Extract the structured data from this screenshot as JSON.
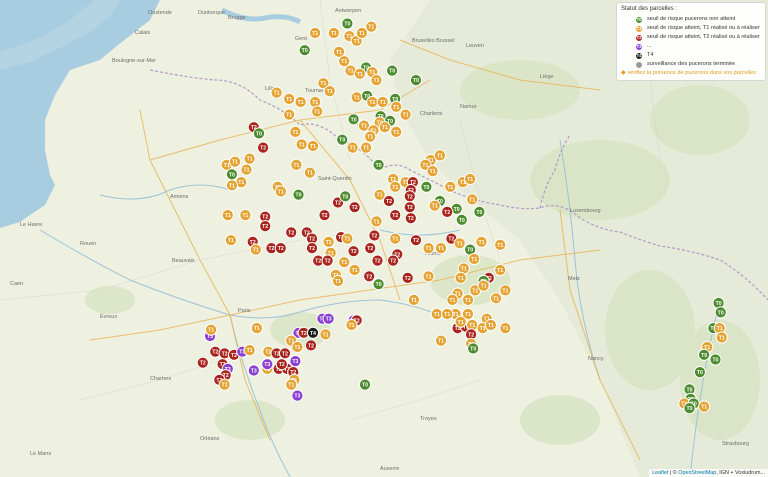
{
  "colors": {
    "T0": "#4c8c2f",
    "T1": "#e5a333",
    "T2": "#a8241d",
    "T3": "#8a3fd1",
    "T4": "#1a1a1a",
    "done": "#9a9a9a",
    "link": "#e69a1c"
  },
  "place_labels": [
    "Oostende",
    "Brugge",
    "Gent",
    "Antwerpen",
    "Bruxelles Brussel",
    "Leuven",
    "Liège",
    "Namur",
    "Charleroi",
    "Mons",
    "Lille",
    "Tournai",
    "Dunkerque",
    "Calais",
    "Boulogne-sur-Mer",
    "Amiens",
    "Saint-Quentin",
    "Reims",
    "Paris",
    "Beauvais",
    "Rouen",
    "Le Havre",
    "Caen",
    "Chartres",
    "Orléans",
    "Troyes",
    "Metz",
    "Nancy",
    "Luxembourg",
    "Strasbourg",
    "Évreux",
    "Le Mans",
    "Auxerre"
  ],
  "legend": {
    "title": "Statut des parcelles :",
    "items": [
      {
        "badge": "T0",
        "label": "seuil de risque pucerons non atteint",
        "color_key": "T0"
      },
      {
        "badge": "T1",
        "label": "seuil de risque atteint, T1 réalisé ou à réaliser",
        "color_key": "T1"
      },
      {
        "badge": "T2",
        "label": "seuil de risque atteint, T2 réalisé ou à réaliser",
        "color_key": "T2"
      },
      {
        "badge": "T3",
        "label": "...",
        "color_key": "T3"
      },
      {
        "badge": "T4",
        "label": "T4",
        "color_key": "T4"
      },
      {
        "badge": "",
        "label": "surveillance des pucerons terminée",
        "color_key": "done"
      }
    ],
    "link": "vérifiez la présence de pucerons dans vos parcelles"
  },
  "attribution": {
    "leaflet": "Leaflet",
    "sep": " | © ",
    "osm": "OpenStreetMap",
    "rest": ", IGN + Voxiudrum..."
  },
  "markers": [
    {
      "t": "T0",
      "lng": 2.84,
      "lat": 51.29
    },
    {
      "t": "T1",
      "lng": 2.53,
      "lat": 51.23
    },
    {
      "t": "T1",
      "lng": 2.71,
      "lat": 51.23
    },
    {
      "t": "T1",
      "lng": 2.86,
      "lat": 51.21
    },
    {
      "t": "T1",
      "lng": 2.93,
      "lat": 51.18
    },
    {
      "t": "T1",
      "lng": 2.98,
      "lat": 51.23
    },
    {
      "t": "T1",
      "lng": 3.07,
      "lat": 51.27
    },
    {
      "t": "T0",
      "lng": 2.43,
      "lat": 51.12
    },
    {
      "t": "T1",
      "lng": 2.76,
      "lat": 51.11
    },
    {
      "t": "T1",
      "lng": 2.81,
      "lat": 51.05
    },
    {
      "t": "T0",
      "lng": 3.02,
      "lat": 51.01
    },
    {
      "t": "T1",
      "lng": 2.87,
      "lat": 50.99
    },
    {
      "t": "T1",
      "lng": 2.96,
      "lat": 50.97
    },
    {
      "t": "T1",
      "lng": 3.08,
      "lat": 50.98
    },
    {
      "t": "T1",
      "lng": 3.12,
      "lat": 50.93
    },
    {
      "t": "T0",
      "lng": 3.27,
      "lat": 50.99
    },
    {
      "t": "T0",
      "lng": 3.5,
      "lat": 50.93
    },
    {
      "t": "T1",
      "lng": 2.61,
      "lat": 50.91
    },
    {
      "t": "T1",
      "lng": 2.67,
      "lat": 50.86
    },
    {
      "t": "T1",
      "lng": 2.16,
      "lat": 50.85
    },
    {
      "t": "T1",
      "lng": 2.28,
      "lat": 50.81
    },
    {
      "t": "T1",
      "lng": 2.39,
      "lat": 50.79
    },
    {
      "t": "T1",
      "lng": 2.53,
      "lat": 50.79
    },
    {
      "t": "T1",
      "lng": 2.93,
      "lat": 50.82
    },
    {
      "t": "T0",
      "lng": 3.03,
      "lat": 50.83
    },
    {
      "t": "T1",
      "lng": 3.08,
      "lat": 50.79
    },
    {
      "t": "T1",
      "lng": 3.18,
      "lat": 50.79
    },
    {
      "t": "T0",
      "lng": 3.3,
      "lat": 50.81
    },
    {
      "t": "T1",
      "lng": 3.31,
      "lat": 50.76
    },
    {
      "t": "T1",
      "lng": 2.28,
      "lat": 50.71
    },
    {
      "t": "T1",
      "lng": 2.55,
      "lat": 50.73
    },
    {
      "t": "T0",
      "lng": 2.9,
      "lat": 50.68
    },
    {
      "t": "T0",
      "lng": 3.16,
      "lat": 50.7
    },
    {
      "t": "T0",
      "lng": 3.25,
      "lat": 50.67
    },
    {
      "t": "T1",
      "lng": 3.4,
      "lat": 50.71
    },
    {
      "t": "T1",
      "lng": 3.15,
      "lat": 50.66
    },
    {
      "t": "T1",
      "lng": 3.2,
      "lat": 50.63
    },
    {
      "t": "T1",
      "lng": 3.0,
      "lat": 50.64
    },
    {
      "t": "T1",
      "lng": 3.09,
      "lat": 50.61
    },
    {
      "t": "T1",
      "lng": 3.06,
      "lat": 50.57
    },
    {
      "t": "T1",
      "lng": 3.31,
      "lat": 50.6
    },
    {
      "t": "T2",
      "lng": 1.94,
      "lat": 50.63
    },
    {
      "t": "T0",
      "lng": 1.99,
      "lat": 50.59
    },
    {
      "t": "T1",
      "lng": 2.34,
      "lat": 50.6
    },
    {
      "t": "T0",
      "lng": 2.79,
      "lat": 50.55
    },
    {
      "t": "T2",
      "lng": 2.03,
      "lat": 50.5
    },
    {
      "t": "T1",
      "lng": 2.4,
      "lat": 50.52
    },
    {
      "t": "T1",
      "lng": 2.51,
      "lat": 50.51
    },
    {
      "t": "T1",
      "lng": 2.89,
      "lat": 50.5
    },
    {
      "t": "T1",
      "lng": 3.02,
      "lat": 50.5
    },
    {
      "t": "T1",
      "lng": 1.68,
      "lat": 50.39
    },
    {
      "t": "T1",
      "lng": 1.76,
      "lat": 50.41
    },
    {
      "t": "T1",
      "lng": 1.9,
      "lat": 50.43
    },
    {
      "t": "T0",
      "lng": 1.73,
      "lat": 50.33
    },
    {
      "t": "T1",
      "lng": 1.87,
      "lat": 50.36
    },
    {
      "t": "T1",
      "lng": 2.35,
      "lat": 50.39
    },
    {
      "t": "T1",
      "lng": 2.48,
      "lat": 50.34
    },
    {
      "t": "T0",
      "lng": 3.14,
      "lat": 50.39
    },
    {
      "t": "T1",
      "lng": 3.64,
      "lat": 50.42
    },
    {
      "t": "T1",
      "lng": 3.73,
      "lat": 50.45
    },
    {
      "t": "T1",
      "lng": 3.59,
      "lat": 50.39
    },
    {
      "t": "T1",
      "lng": 3.66,
      "lat": 50.35
    },
    {
      "t": "T1",
      "lng": 1.82,
      "lat": 50.28
    },
    {
      "t": "T1",
      "lng": 1.73,
      "lat": 50.26
    },
    {
      "t": "T1",
      "lng": 2.17,
      "lat": 50.25
    },
    {
      "t": "T1",
      "lng": 2.2,
      "lat": 50.22
    },
    {
      "t": "T0",
      "lng": 2.37,
      "lat": 50.2
    },
    {
      "t": "T2",
      "lng": 2.75,
      "lat": 50.15
    },
    {
      "t": "T0",
      "lng": 2.82,
      "lat": 50.19
    },
    {
      "t": "T1",
      "lng": 3.28,
      "lat": 50.3
    },
    {
      "t": "T1",
      "lng": 3.3,
      "lat": 50.25
    },
    {
      "t": "T1",
      "lng": 3.15,
      "lat": 50.2
    },
    {
      "t": "T1",
      "lng": 3.4,
      "lat": 50.28
    },
    {
      "t": "T2",
      "lng": 3.47,
      "lat": 50.28
    },
    {
      "t": "T2",
      "lng": 3.45,
      "lat": 50.23
    },
    {
      "t": "T0",
      "lng": 3.6,
      "lat": 50.25
    },
    {
      "t": "T1",
      "lng": 3.83,
      "lat": 50.25
    },
    {
      "t": "T1",
      "lng": 3.95,
      "lat": 50.28
    },
    {
      "t": "T1",
      "lng": 4.02,
      "lat": 50.3
    },
    {
      "t": "T2",
      "lng": 2.91,
      "lat": 50.12
    },
    {
      "t": "T2",
      "lng": 3.24,
      "lat": 50.16
    },
    {
      "t": "T2",
      "lng": 3.44,
      "lat": 50.19
    },
    {
      "t": "T2",
      "lng": 3.44,
      "lat": 50.12
    },
    {
      "t": "T0",
      "lng": 3.73,
      "lat": 50.16
    },
    {
      "t": "T0",
      "lng": 3.89,
      "lat": 50.11
    },
    {
      "t": "T2",
      "lng": 3.8,
      "lat": 50.09
    },
    {
      "t": "T0",
      "lng": 3.94,
      "lat": 50.04
    },
    {
      "t": "T0",
      "lng": 4.11,
      "lat": 50.09
    },
    {
      "t": "T1",
      "lng": 4.04,
      "lat": 50.17
    },
    {
      "t": "T2",
      "lng": 2.62,
      "lat": 50.07
    },
    {
      "t": "T1",
      "lng": 3.12,
      "lat": 50.03
    },
    {
      "t": "T2",
      "lng": 3.3,
      "lat": 50.07
    },
    {
      "t": "T2",
      "lng": 3.45,
      "lat": 50.05
    },
    {
      "t": "T1",
      "lng": 3.68,
      "lat": 50.13
    },
    {
      "t": "T1",
      "lng": 1.69,
      "lat": 50.07
    },
    {
      "t": "T1",
      "lng": 1.86,
      "lat": 50.07
    },
    {
      "t": "T2",
      "lng": 2.05,
      "lat": 50.06
    },
    {
      "t": "T2",
      "lng": 2.05,
      "lat": 50.0
    },
    {
      "t": "T2",
      "lng": 2.3,
      "lat": 49.96
    },
    {
      "t": "T2",
      "lng": 2.45,
      "lat": 49.96
    },
    {
      "t": "T2",
      "lng": 2.5,
      "lat": 49.92
    },
    {
      "t": "T2",
      "lng": 2.5,
      "lat": 49.86
    },
    {
      "t": "T1",
      "lng": 2.66,
      "lat": 49.9
    },
    {
      "t": "T2",
      "lng": 2.78,
      "lat": 49.93
    },
    {
      "t": "T1",
      "lng": 2.84,
      "lat": 49.92
    },
    {
      "t": "T2",
      "lng": 3.1,
      "lat": 49.94
    },
    {
      "t": "T2",
      "lng": 3.5,
      "lat": 49.91
    },
    {
      "t": "T1",
      "lng": 3.3,
      "lat": 49.92
    },
    {
      "t": "T1",
      "lng": 1.72,
      "lat": 49.91
    },
    {
      "t": "T2",
      "lng": 1.93,
      "lat": 49.9
    },
    {
      "t": "T1",
      "lng": 1.96,
      "lat": 49.85
    },
    {
      "t": "T2",
      "lng": 2.11,
      "lat": 49.86
    },
    {
      "t": "T2",
      "lng": 2.2,
      "lat": 49.86
    },
    {
      "t": "T1",
      "lng": 2.68,
      "lat": 49.83
    },
    {
      "t": "T2",
      "lng": 2.9,
      "lat": 49.84
    },
    {
      "t": "T2",
      "lng": 3.06,
      "lat": 49.86
    },
    {
      "t": "T2",
      "lng": 3.32,
      "lat": 49.82
    },
    {
      "t": "T1",
      "lng": 3.62,
      "lat": 49.86
    },
    {
      "t": "T1",
      "lng": 3.74,
      "lat": 49.86
    },
    {
      "t": "T2",
      "lng": 3.84,
      "lat": 49.92
    },
    {
      "t": "T1",
      "lng": 3.92,
      "lat": 49.89
    },
    {
      "t": "T1",
      "lng": 4.13,
      "lat": 49.9
    },
    {
      "t": "T0",
      "lng": 4.02,
      "lat": 49.85
    },
    {
      "t": "T1",
      "lng": 4.31,
      "lat": 49.88
    },
    {
      "t": "T2",
      "lng": 2.56,
      "lat": 49.78
    },
    {
      "t": "T2",
      "lng": 2.65,
      "lat": 49.78
    },
    {
      "t": "T1",
      "lng": 2.81,
      "lat": 49.77
    },
    {
      "t": "T1",
      "lng": 2.91,
      "lat": 49.72
    },
    {
      "t": "T2",
      "lng": 3.13,
      "lat": 49.78
    },
    {
      "t": "T2",
      "lng": 3.28,
      "lat": 49.78
    },
    {
      "t": "T2",
      "lng": 3.05,
      "lat": 49.68
    },
    {
      "t": "T1",
      "lng": 2.73,
      "lat": 49.69
    },
    {
      "t": "T1",
      "lng": 2.75,
      "lat": 49.65
    },
    {
      "t": "T0",
      "lng": 3.14,
      "lat": 49.63
    },
    {
      "t": "T2",
      "lng": 3.42,
      "lat": 49.67
    },
    {
      "t": "T1",
      "lng": 3.62,
      "lat": 49.68
    },
    {
      "t": "T1",
      "lng": 3.96,
      "lat": 49.73
    },
    {
      "t": "T1",
      "lng": 3.93,
      "lat": 49.67
    },
    {
      "t": "T1",
      "lng": 4.31,
      "lat": 49.72
    },
    {
      "t": "T1",
      "lng": 4.06,
      "lat": 49.79
    },
    {
      "t": "T2",
      "lng": 4.2,
      "lat": 49.67
    },
    {
      "t": "T0",
      "lng": 4.15,
      "lat": 49.65
    },
    {
      "t": "T1",
      "lng": 3.48,
      "lat": 49.53
    },
    {
      "t": "T1",
      "lng": 3.9,
      "lat": 49.57
    },
    {
      "t": "T1",
      "lng": 4.07,
      "lat": 49.59
    },
    {
      "t": "T1",
      "lng": 4.15,
      "lat": 49.62
    },
    {
      "t": "T1",
      "lng": 4.0,
      "lat": 49.53
    },
    {
      "t": "T1",
      "lng": 3.85,
      "lat": 49.53
    },
    {
      "t": "T1",
      "lng": 4.27,
      "lat": 49.54
    },
    {
      "t": "T1",
      "lng": 4.36,
      "lat": 49.59
    },
    {
      "t": "T1",
      "lng": 3.88,
      "lat": 49.44
    },
    {
      "t": "T1",
      "lng": 4.0,
      "lat": 49.44
    },
    {
      "t": "T1",
      "lng": 4.18,
      "lat": 49.41
    },
    {
      "t": "T1",
      "lng": 3.7,
      "lat": 49.44
    },
    {
      "t": "T1",
      "lng": 3.8,
      "lat": 49.44
    },
    {
      "t": "T3",
      "lng": 2.6,
      "lat": 49.41
    },
    {
      "t": "T3",
      "lng": 2.66,
      "lat": 49.41
    },
    {
      "t": "T3",
      "lng": 2.9,
      "lat": 49.4
    },
    {
      "t": "T2",
      "lng": 2.93,
      "lat": 49.4
    },
    {
      "t": "T1",
      "lng": 2.88,
      "lat": 49.37
    },
    {
      "t": "T2",
      "lng": 3.9,
      "lat": 49.35
    },
    {
      "t": "T2",
      "lng": 3.98,
      "lat": 49.36
    },
    {
      "t": "T1",
      "lng": 3.93,
      "lat": 49.39
    },
    {
      "t": "T1",
      "lng": 4.04,
      "lat": 49.37
    },
    {
      "t": "T1",
      "lng": 4.14,
      "lat": 49.35
    },
    {
      "t": "T1",
      "lng": 4.22,
      "lat": 49.37
    },
    {
      "t": "T1",
      "lng": 4.36,
      "lat": 49.35
    },
    {
      "t": "T3",
      "lng": 1.52,
      "lat": 49.3
    },
    {
      "t": "T1",
      "lng": 1.53,
      "lat": 49.34
    },
    {
      "t": "T1",
      "lng": 1.97,
      "lat": 49.35
    },
    {
      "t": "T3",
      "lng": 2.37,
      "lat": 49.32
    },
    {
      "t": "T2",
      "lng": 2.42,
      "lat": 49.32
    },
    {
      "t": "T4",
      "lng": 2.51,
      "lat": 49.32
    },
    {
      "t": "T1",
      "lng": 2.63,
      "lat": 49.31
    },
    {
      "t": "T1",
      "lng": 2.3,
      "lat": 49.27
    },
    {
      "t": "T1",
      "lng": 2.36,
      "lat": 49.23
    },
    {
      "t": "T2",
      "lng": 2.49,
      "lat": 49.24
    },
    {
      "t": "T2",
      "lng": 4.03,
      "lat": 49.31
    },
    {
      "t": "T1",
      "lng": 4.03,
      "lat": 49.25
    },
    {
      "t": "T0",
      "lng": 4.05,
      "lat": 49.22
    },
    {
      "t": "T1",
      "lng": 3.74,
      "lat": 49.27
    },
    {
      "t": "T2",
      "lng": 1.57,
      "lat": 49.2
    },
    {
      "t": "T2",
      "lng": 1.66,
      "lat": 49.19
    },
    {
      "t": "T2",
      "lng": 1.75,
      "lat": 49.18
    },
    {
      "t": "T3",
      "lng": 1.83,
      "lat": 49.2
    },
    {
      "t": "T1",
      "lng": 1.9,
      "lat": 49.21
    },
    {
      "t": "T1",
      "lng": 2.08,
      "lat": 49.2
    },
    {
      "t": "T2",
      "lng": 2.16,
      "lat": 49.19
    },
    {
      "t": "T2",
      "lng": 2.24,
      "lat": 49.19
    },
    {
      "t": "T3",
      "lng": 2.34,
      "lat": 49.14
    },
    {
      "t": "T2",
      "lng": 1.45,
      "lat": 49.13
    },
    {
      "t": "T2",
      "lng": 1.64,
      "lat": 49.12
    },
    {
      "t": "T3",
      "lng": 1.69,
      "lat": 49.09
    },
    {
      "t": "T2",
      "lng": 1.67,
      "lat": 49.05
    },
    {
      "t": "T3",
      "lng": 1.94,
      "lat": 49.08
    },
    {
      "t": "T1",
      "lng": 2.07,
      "lat": 49.09
    },
    {
      "t": "T2",
      "lng": 2.18,
      "lat": 49.09
    },
    {
      "t": "T2",
      "lng": 2.26,
      "lat": 49.09
    },
    {
      "t": "T2",
      "lng": 2.32,
      "lat": 49.07
    },
    {
      "t": "T3",
      "lng": 2.07,
      "lat": 49.12
    },
    {
      "t": "T2",
      "lng": 2.21,
      "lat": 49.12
    },
    {
      "t": "T2",
      "lng": 1.61,
      "lat": 49.02
    },
    {
      "t": "T1",
      "lng": 1.66,
      "lat": 48.99
    },
    {
      "t": "T1",
      "lng": 2.33,
      "lat": 49.02
    },
    {
      "t": "T1",
      "lng": 2.3,
      "lat": 48.99
    },
    {
      "t": "T3",
      "lng": 2.36,
      "lat": 48.92
    },
    {
      "t": "T0",
      "lng": 3.01,
      "lat": 48.99
    },
    {
      "t": "T0",
      "lng": 6.41,
      "lat": 49.51
    },
    {
      "t": "T0",
      "lng": 6.43,
      "lat": 49.45
    },
    {
      "t": "T0",
      "lng": 6.36,
      "lat": 49.35
    },
    {
      "t": "T1",
      "lng": 6.42,
      "lat": 49.35
    },
    {
      "t": "T1",
      "lng": 6.44,
      "lat": 49.29
    },
    {
      "t": "T1",
      "lng": 6.3,
      "lat": 49.23
    },
    {
      "t": "T0",
      "lng": 6.27,
      "lat": 49.18
    },
    {
      "t": "T0",
      "lng": 6.38,
      "lat": 49.15
    },
    {
      "t": "T0",
      "lng": 6.23,
      "lat": 49.07
    },
    {
      "t": "T0",
      "lng": 6.13,
      "lat": 48.96
    },
    {
      "t": "T0",
      "lng": 6.14,
      "lat": 48.9
    },
    {
      "t": "T1",
      "lng": 6.08,
      "lat": 48.87
    },
    {
      "t": "T0",
      "lng": 6.17,
      "lat": 48.87
    },
    {
      "t": "T0",
      "lng": 6.13,
      "lat": 48.84
    },
    {
      "t": "T1",
      "lng": 6.27,
      "lat": 48.85
    }
  ]
}
